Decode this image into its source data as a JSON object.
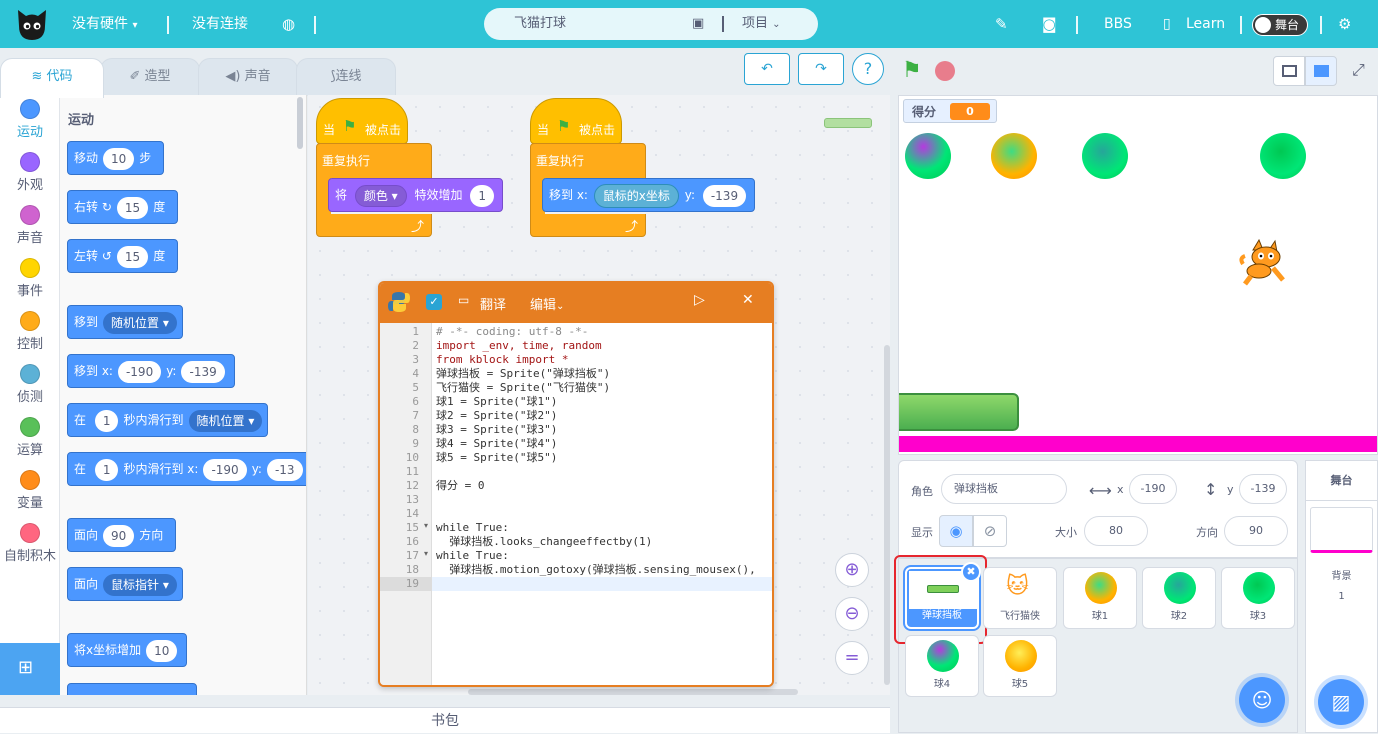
{
  "topbar": {
    "hardware": "没有硬件",
    "connection": "没有连接",
    "project_title": "飞猫打球",
    "project_menu": "项目",
    "bbs": "BBS",
    "learn": "Learn",
    "stage_toggle": "舞台"
  },
  "tabs": {
    "code": "代码",
    "costume": "造型",
    "sound": "声音",
    "wire": "连线"
  },
  "categories": [
    {
      "label": "运动",
      "color": "#4c97ff"
    },
    {
      "label": "外观",
      "color": "#9966ff"
    },
    {
      "label": "声音",
      "color": "#cf63cf"
    },
    {
      "label": "事件",
      "color": "#ffd500"
    },
    {
      "label": "控制",
      "color": "#ffab19"
    },
    {
      "label": "侦测",
      "color": "#5cb1d6"
    },
    {
      "label": "运算",
      "color": "#59c059"
    },
    {
      "label": "变量",
      "color": "#ff8c1a"
    },
    {
      "label": "自制积木",
      "color": "#ff6680"
    }
  ],
  "palette": {
    "section": "运动",
    "move": {
      "label": "移动",
      "value": "10",
      "unit": "步"
    },
    "turn_right": {
      "label": "右转",
      "value": "15",
      "unit": "度"
    },
    "turn_left": {
      "label": "左转",
      "value": "15",
      "unit": "度"
    },
    "goto": {
      "label": "移到",
      "option": "随机位置"
    },
    "gotoxy": {
      "label": "移到 x:",
      "x": "-190",
      "ylabel": "y:",
      "y": "-139"
    },
    "glide": {
      "label": "在",
      "secs": "1",
      "mid": "秒内滑行到",
      "option": "随机位置"
    },
    "glidexy": {
      "label": "在",
      "secs": "1",
      "mid": "秒内滑行到 x:",
      "x": "-190",
      "ylabel": "y:",
      "y": "-13"
    },
    "point_dir": {
      "label": "面向",
      "value": "90",
      "unit": "方向"
    },
    "point_towards": {
      "label": "面向",
      "option": "鼠标指针"
    },
    "change_x": {
      "label": "将x坐标增加",
      "value": "10"
    }
  },
  "scripts": {
    "script1": {
      "hat_when": "当",
      "hat_clicked": "被点击",
      "forever": "重复执行",
      "effect_label": "将",
      "effect_option": "颜色",
      "effect_mid": "特效增加",
      "effect_value": "1"
    },
    "script2": {
      "hat_when": "当",
      "hat_clicked": "被点击",
      "forever": "重复执行",
      "goto_label": "移到 x:",
      "goto_reporter": "鼠标的x坐标",
      "ylabel": "y:",
      "y": "-139"
    }
  },
  "codewin": {
    "translate": "翻译",
    "edit": "编辑",
    "line_numbers": [
      "1",
      "2",
      "3",
      "4",
      "5",
      "6",
      "7",
      "8",
      "9",
      "10",
      "11",
      "12",
      "13",
      "14",
      "15",
      "16",
      "17",
      "18",
      "19"
    ],
    "lines": [
      "# -*- coding: utf-8 -*-",
      "import _env, time, random",
      "from kblock import *",
      "弹球挡板 = Sprite(\"弹球挡板\")",
      "飞行猫侠 = Sprite(\"飞行猫侠\")",
      "球1 = Sprite(\"球1\")",
      "球2 = Sprite(\"球2\")",
      "球3 = Sprite(\"球3\")",
      "球4 = Sprite(\"球4\")",
      "球5 = Sprite(\"球5\")",
      "",
      "得分 = 0",
      "",
      "",
      "while True:",
      "  弹球挡板.looks_changeeffectby(1)",
      "while True:",
      "  弹球挡板.motion_gotoxy(弹球挡板.sensing_mousex(),",
      ""
    ]
  },
  "stage": {
    "score_label": "得分",
    "score_value": "0"
  },
  "sprite_info": {
    "role_label": "角色",
    "role_name": "弹球挡板",
    "x_label": "x",
    "x": "-190",
    "y_label": "y",
    "y": "-139",
    "show_label": "显示",
    "size_label": "大小",
    "size": "80",
    "dir_label": "方向",
    "dir": "90"
  },
  "sprites": [
    {
      "name": "弹球挡板"
    },
    {
      "name": "飞行猫侠"
    },
    {
      "name": "球1"
    },
    {
      "name": "球2"
    },
    {
      "name": "球3"
    },
    {
      "name": "球4"
    },
    {
      "name": "球5"
    }
  ],
  "stage_panel": {
    "title": "舞台",
    "backdrop_label": "背景",
    "backdrop_count": "1"
  },
  "backpack": "书包",
  "colors": {
    "accent": "#2ec4d6",
    "motion": "#4c97ff",
    "events": "#ffbf00",
    "control": "#ffab19",
    "looks": "#9966ff",
    "highlight": "#e6262e"
  }
}
